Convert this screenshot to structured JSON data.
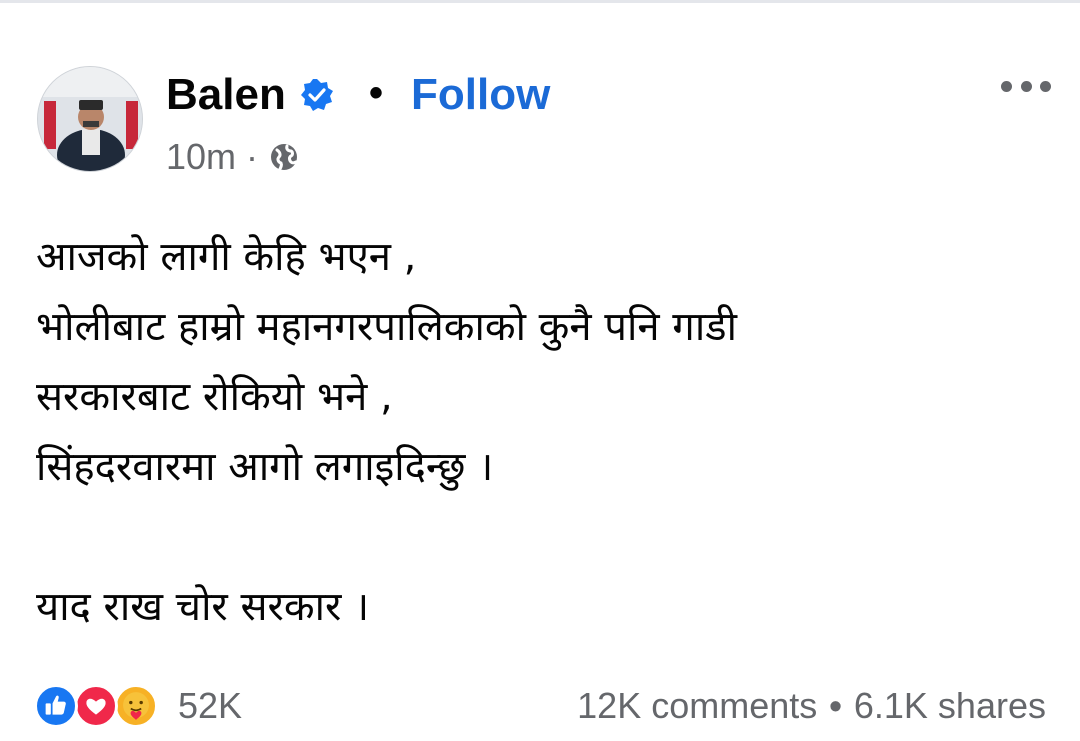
{
  "post": {
    "author": "Balen",
    "separator": "•",
    "follow_label": "Follow",
    "time": "10m",
    "meta_separator": "·",
    "audience_icon": "globe-icon",
    "verified_icon": "verified-badge-icon",
    "more_icon": "more-options-icon",
    "body_lines": [
      "आजको लागी केहि भएन ,",
      "भोलीबाट हाम्रो महानगरपालिकाको कुनै पनि गाडी",
      "सरकारबाट रोकियो भने ,",
      "सिंहदरवारमा आगो लगाइदिन्छु ।",
      "",
      "याद राख चोर सरकार ।"
    ],
    "reactions": {
      "icons": [
        "like-icon",
        "love-icon",
        "care-icon"
      ],
      "count": "52K"
    },
    "comments": "12K comments",
    "stats_separator": "•",
    "shares": "6.1K shares"
  },
  "colors": {
    "link_blue": "#1b6ad6",
    "verified_blue": "#1877f2",
    "text_primary": "#050505",
    "text_secondary": "#65676b"
  }
}
